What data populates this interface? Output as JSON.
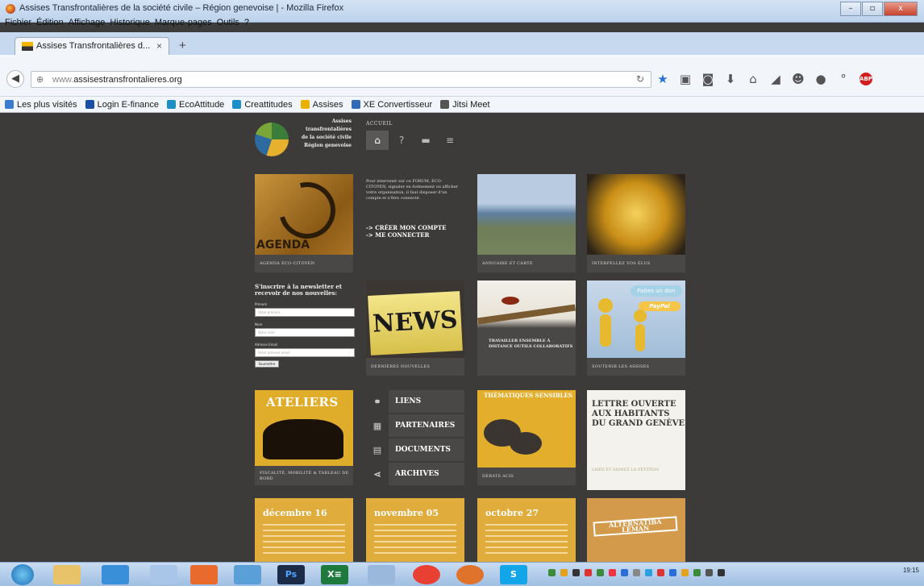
{
  "window": {
    "title": "Assises Transfrontalières de la société civile – Région genevoise | - Mozilla Firefox",
    "buttons": {
      "min": "–",
      "max": "▫",
      "close": "x"
    }
  },
  "menu": [
    "Fichier",
    "Édition",
    "Affichage",
    "Historique",
    "Marque-pages",
    "Outils",
    "?"
  ],
  "tab": {
    "label": "Assises Transfrontalières d...",
    "close": "×",
    "new": "+"
  },
  "url": {
    "prefix": "www.",
    "domain": "assisestransfrontalieres.org"
  },
  "bookmarks": [
    {
      "label": "Les plus visités",
      "color": "#3b7bd0"
    },
    {
      "label": "Login E-finance",
      "color": "#1b4fa6"
    },
    {
      "label": "EcoAttitude",
      "color": "#1d8fc7"
    },
    {
      "label": "Creattitudes",
      "color": "#1d8fc7"
    },
    {
      "label": "Assises",
      "color": "#e8b100"
    },
    {
      "label": "XE Convertisseur",
      "color": "#2f6bb7"
    },
    {
      "label": "Jitsi Meet",
      "color": "#555555"
    }
  ],
  "site": {
    "logo_lines": [
      "Assises",
      "transfrontalières",
      "de la société civile",
      "Région genevoise"
    ],
    "nav_label": "ACCUEIL",
    "tiles": {
      "agenda_word": "AGENDA",
      "agenda_cap": "AGENDA ÉCO-CITOYEN",
      "text_para": "Pour intervenir sur ce FORUM, ÉCO-CITOYEN, signaler en événement ou afficher votre organisation, il faut disposer d'un compte et s'être connecté.",
      "link_create": "-> CRÉER MON COMPTE",
      "link_connect": "-> ME CONNECTER",
      "annuaire_cap": "ANNUAIRE ET CARTE",
      "intern_cap": "INTERPELLEZ VOS ÉLUS",
      "newsletter_title": "S'inscrire à la newsletter et recevoir de nos nouvelles:",
      "prenom_label": "Prénom",
      "prenom_ph": "Votre prénom",
      "nom_label": "Nom",
      "nom_ph": "Votre nom",
      "email_label": "Adresse Email",
      "email_ph": "Votre adresse email",
      "submit": "Soumettre",
      "news_word": "NEWS",
      "news_cap": "DERNIÈRES NOUVELLES",
      "travail_text": "TRAVAILLER ENSEMBLE À DISTANCE OUTILS COLLABORATIFS",
      "don_pill": "Faites un don",
      "don_paypal": "PayPal",
      "don_cap": "SOUTENIR LES ASSISES",
      "ateliers_title": "ATELIERS",
      "ateliers_cap": "FISCALITÉ, MOBILITÉ & TABLEAU DE BORD",
      "links": [
        "LIENS",
        "PARTENAIRES",
        "DOCUMENTS",
        "ARCHIVES"
      ],
      "thema_title": "THÉMATIQUES SENSIBLES",
      "thema_cap": "DÉBATS ACIS",
      "lettre_title": "LETTRE OUVERTE AUX HABITANTS DU GRAND GENÈVE",
      "lettre_sub": "LISEZ ET SIGNEZ LA PÉTITION",
      "dates": [
        "décembre 16",
        "novembre 05",
        "octobre 27"
      ],
      "altern_title": "ALTERNATIBA LÉMAN"
    }
  },
  "taskbar": {
    "apps": [
      "Ps",
      "X≡"
    ],
    "clock": "19:15"
  }
}
